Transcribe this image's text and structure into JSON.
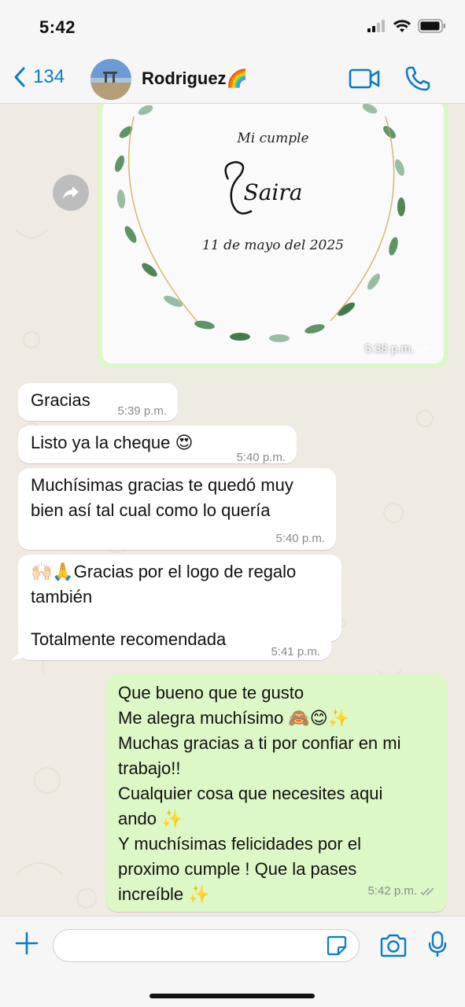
{
  "status": {
    "time": "5:42"
  },
  "header": {
    "back_count": "134",
    "contact_name": "Rodriguez🌈"
  },
  "image_message": {
    "invitation_line1": "Mi cumple",
    "invitation_name": "Saira",
    "invitation_date": "11 de mayo del 2025",
    "time": "5:38 p.m."
  },
  "messages": [
    {
      "text": "Gracias",
      "time": "5:39 p.m."
    },
    {
      "text": "Listo ya la cheque 😍",
      "time": "5:40 p.m."
    },
    {
      "text": "Muchísimas gracias te quedó muy bien así tal cual como lo quería",
      "time": "5:40 p.m."
    },
    {
      "text": "🙌🏻🙏Gracias por el logo de regalo también",
      "time": "5:41 p.m."
    },
    {
      "text": "Totalmente recomendada",
      "time": "5:41 p.m."
    }
  ],
  "outgoing": {
    "lines": [
      "Que bueno que te gusto",
      "Me alegra muchísimo 🙈😊✨",
      "Muchas gracias a ti por confiar en mi",
      "trabajo!!",
      "Cualquier cosa que necesites aqui",
      "ando ✨",
      "Y muchísimas felicidades por el",
      "proximo cumple ! Que la pases",
      "increíble ✨"
    ],
    "time": "5:42 p.m."
  },
  "input": {
    "placeholder": ""
  },
  "colors": {
    "accent": "#0a7cc7",
    "outgoing_bubble": "#dcf8c6",
    "incoming_bubble": "#ffffff",
    "chat_bg": "#efeae2"
  },
  "icons": [
    "back-chevron-icon",
    "video-call-icon",
    "phone-icon",
    "forward-icon",
    "plus-icon",
    "sticker-icon",
    "camera-icon",
    "microphone-icon",
    "read-receipt-icon"
  ]
}
